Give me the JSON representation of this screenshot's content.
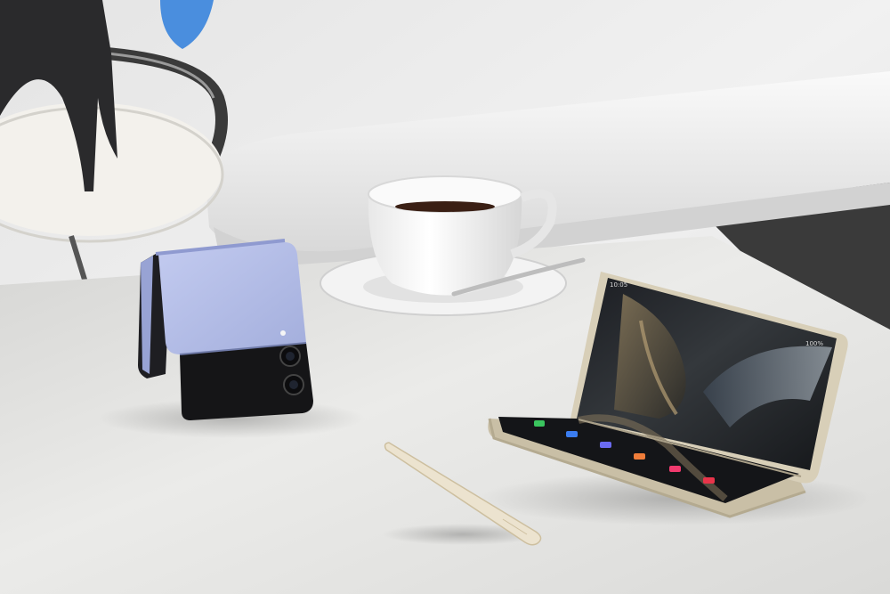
{
  "scene": {
    "palette": {
      "wall": "#ececec",
      "sofa": "#f2f2f2",
      "table": "#e6e6e4",
      "side_table": "#f3f1ec",
      "sculpture": "#2a2a2c",
      "accent_blue": "#4a8ede",
      "flip_phone_lavender": "#b3bde6",
      "flip_phone_black": "#151517",
      "fold_phone_frame": "#d8cfb8",
      "stylus": "#ece3cf"
    },
    "fold_phone_screen": {
      "time": "10:05",
      "battery": "100%",
      "app_icon_colors": [
        "#3ac45e",
        "#3b7df0",
        "#6b6bf0",
        "#f07d3a",
        "#f03a6e",
        "#e8344a"
      ]
    }
  }
}
